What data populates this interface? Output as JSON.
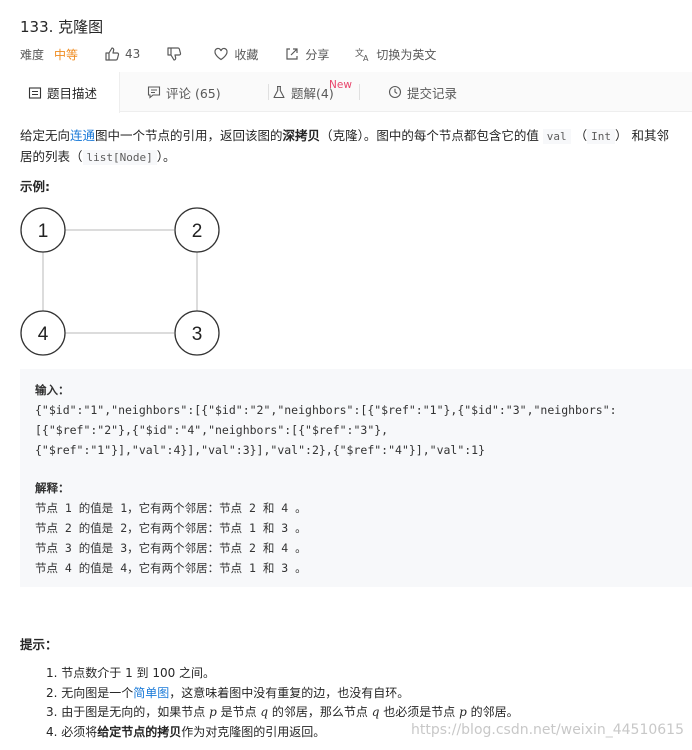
{
  "header": {
    "title": "133. 克隆图",
    "difficulty_label": "难度",
    "difficulty": "中等",
    "like_count": "43",
    "favorite_label": "收藏",
    "share_label": "分享",
    "language_switch_label": "切换为英文"
  },
  "tabs": [
    {
      "label": "题目描述"
    },
    {
      "label": "评论 (65)"
    },
    {
      "label": "题解(4)",
      "badge": "New"
    },
    {
      "label": "提交记录"
    }
  ],
  "description": {
    "p1_a": "给定无向",
    "p1_link": "连通",
    "p1_b": "图中一个节点的引用，返回该图的",
    "p1_bold": "深拷贝",
    "p1_c": "（克隆）。图中的每个节点都包含它的值 ",
    "code_val": "val",
    "p1_d": " （",
    "code_int": "Int",
    "p1_e": "） 和其邻",
    "p2_a": "居的列表（",
    "code_list": "list[Node]",
    "p2_b": "）。"
  },
  "example": {
    "heading": "示例:",
    "nodes": [
      "1",
      "2",
      "3",
      "4"
    ],
    "input_label": "输入：",
    "input_lines": [
      "{\"$id\":\"1\",\"neighbors\":[{\"$id\":\"2\",\"neighbors\":[{\"$ref\":\"1\"},{\"$id\":\"3\",\"neighbors\":",
      "[{\"$ref\":\"2\"},{\"$id\":\"4\",\"neighbors\":[{\"$ref\":\"3\"},",
      "{\"$ref\":\"1\"}],\"val\":4}],\"val\":3}],\"val\":2},{\"$ref\":\"4\"}],\"val\":1}"
    ],
    "explain_label": "解释：",
    "explain_lines": [
      "节点 1 的值是 1，它有两个邻居：节点 2 和 4 。",
      "节点 2 的值是 2，它有两个邻居：节点 1 和 3 。",
      "节点 3 的值是 3，它有两个邻居：节点 2 和 4 。",
      "节点 4 的值是 4，它有两个邻居：节点 1 和 3 。"
    ]
  },
  "tips": {
    "heading": "提示：",
    "item1": "1. 节点数介于 1 到 100 之间。",
    "item2_a": "2. 无向图是一个",
    "item2_link": "简单图",
    "item2_b": "，这意味着图中没有重复的边，也没有自环。",
    "item3_a": "3. 由于图是无向的，如果节点 ",
    "item3_p": "p",
    "item3_b": " 是节点 ",
    "item3_q": "q",
    "item3_c": " 的邻居，那么节点 ",
    "item3_q2": "q",
    "item3_d": " 也必须是节点 ",
    "item3_p2": "p",
    "item3_e": " 的邻居。",
    "item4_a": "4. 必须将",
    "item4_bold": "给定节点的拷贝",
    "item4_b": "作为对克隆图的引用返回。"
  },
  "watermark": "https://blog.csdn.net/weixin_44510615",
  "colors": {
    "difficulty": "#ef8b1e",
    "link": "#1a7ad8",
    "new_badge": "#e8456b"
  },
  "icons": [
    "thumbs-up-icon",
    "thumbs-down-icon",
    "heart-icon",
    "share-icon",
    "translate-icon",
    "description-icon",
    "comment-icon",
    "flask-icon",
    "clock-icon"
  ]
}
